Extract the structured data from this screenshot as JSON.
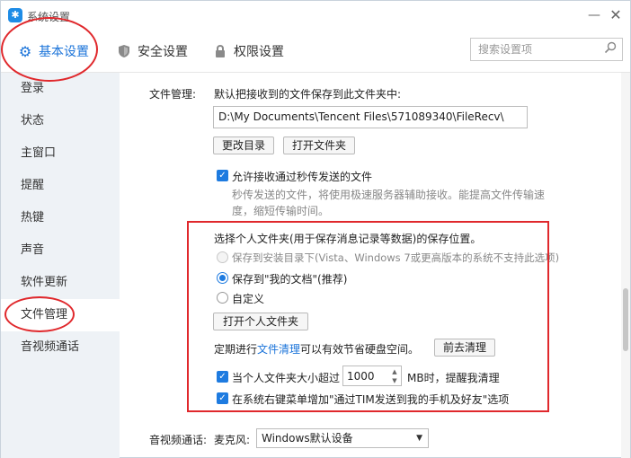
{
  "window": {
    "title": "系统设置",
    "minimize_glyph": "—",
    "close_glyph": "✕"
  },
  "tabs": [
    {
      "label": "基本设置",
      "icon": "gear-icon",
      "active": true
    },
    {
      "label": "安全设置",
      "icon": "shield-icon",
      "active": false
    },
    {
      "label": "权限设置",
      "icon": "lock-icon",
      "active": false
    }
  ],
  "search": {
    "placeholder": "搜索设置项",
    "value": ""
  },
  "sidebar": {
    "items": [
      {
        "label": "登录"
      },
      {
        "label": "状态"
      },
      {
        "label": "主窗口"
      },
      {
        "label": "提醒"
      },
      {
        "label": "热键"
      },
      {
        "label": "声音"
      },
      {
        "label": "软件更新"
      },
      {
        "label": "文件管理",
        "active": true
      },
      {
        "label": "音视频通话"
      }
    ]
  },
  "file_management": {
    "section_label": "文件管理:",
    "default_save_text": "默认把接收到的文件保存到此文件夹中:",
    "path": "D:\\My Documents\\Tencent Files\\571089340\\FileRecv\\",
    "change_dir_button": "更改目录",
    "open_folder_button": "打开文件夹",
    "allow_second_transfer_label": "允许接收通过秒传发送的文件",
    "allow_second_transfer_checked": true,
    "second_transfer_desc_line1": "秒传发送的文件，将使用极速服务器辅助接收。能提高文件传输速",
    "second_transfer_desc_line2": "度，缩短传输时间。"
  },
  "personal_folder": {
    "title": "选择个人文件夹(用于保存消息记录等数据)的保存位置。",
    "option_install_dir": "保存到安装目录下(Vista、Windows 7或更高版本的系统不支持此选项)",
    "option_my_documents": "保存到\"我的文档\"(推荐)",
    "option_custom": "自定义",
    "selected_option": "option_my_documents",
    "open_personal_folder_button": "打开个人文件夹",
    "cleanup_prefix": "定期进行",
    "cleanup_link": "文件清理",
    "cleanup_suffix": "可以有效节省硬盘空间。",
    "go_cleanup_button": "前去清理",
    "size_alert_prefix": "当个人文件夹大小超过",
    "size_alert_value": "1000",
    "size_alert_suffix": "MB时，提醒我清理",
    "size_alert_checked": true,
    "context_menu_label": "在系统右键菜单增加\"通过TIM发送到我的手机及好友\"选项",
    "context_menu_checked": true
  },
  "av_call": {
    "section_label": "音视频通话:",
    "mic_label": "麦克风:",
    "mic_value": "Windows默认设备"
  },
  "colors": {
    "accent": "#1a73d9",
    "annotation": "#e0282c",
    "sidebar_bg": "#eef2f6"
  }
}
